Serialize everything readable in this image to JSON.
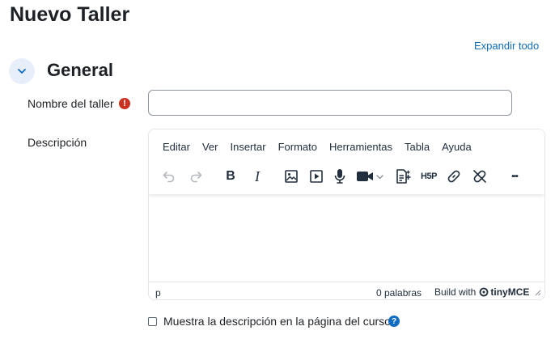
{
  "page": {
    "title": "Nuevo Taller"
  },
  "header": {
    "expand_all": "Expandir todo"
  },
  "section": {
    "title": "General"
  },
  "form": {
    "name_label": "Nombre del taller",
    "required_icon": "!",
    "name_value": "",
    "description_label": "Descripción"
  },
  "editor": {
    "menus": [
      "Editar",
      "Ver",
      "Insertar",
      "Formato",
      "Herramientas",
      "Tabla",
      "Ayuda"
    ],
    "toolbar_icons": [
      "undo-icon",
      "redo-icon",
      "bold-icon",
      "italic-icon",
      "image-icon",
      "media-icon",
      "microphone-icon",
      "video-camera-icon",
      "content-bank-icon",
      "h5p-icon",
      "link-icon",
      "unlink-icon",
      "more-icon"
    ],
    "bold_glyph": "B",
    "italic_glyph": "I",
    "h5p_text": "H5P",
    "more_glyph": "•••",
    "status_path": "p",
    "word_count": "0 palabras",
    "build_with": "Build with",
    "brand": "tinyMCE"
  },
  "options": {
    "show_description_label": "Muestra la descripción en la página del curso",
    "show_description_checked": false,
    "help_icon": "?"
  },
  "colors": {
    "link": "#0f6cbf",
    "required": "#ca3120",
    "collapse_bg": "#e7effa",
    "text": "#1d2125"
  }
}
